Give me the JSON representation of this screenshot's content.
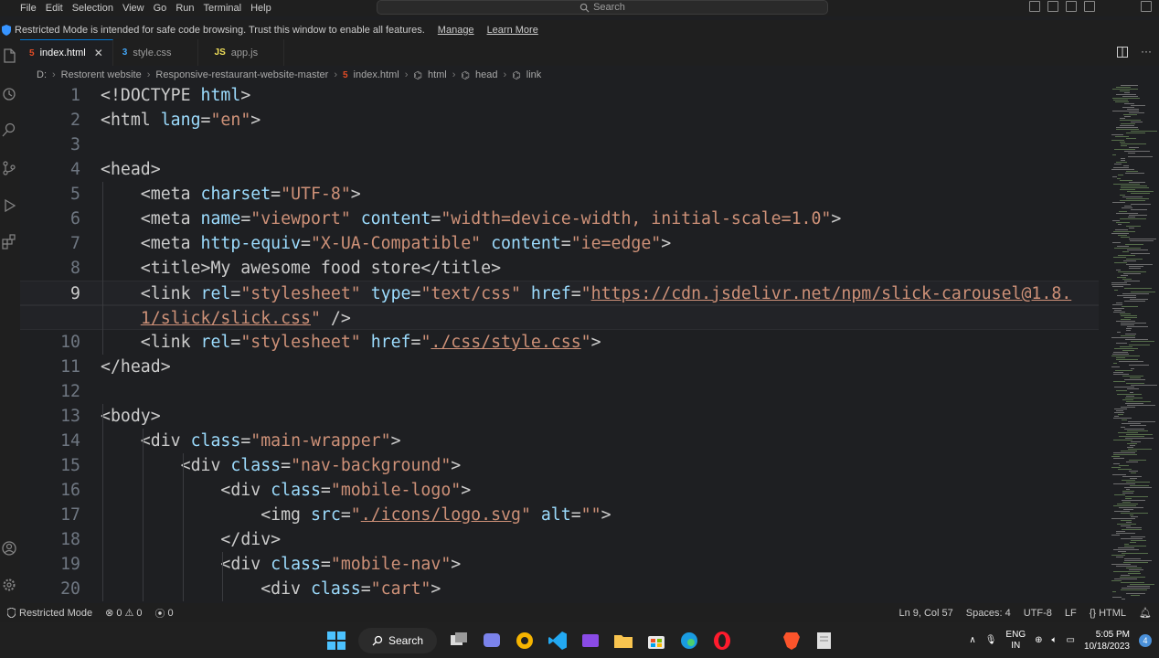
{
  "menu": [
    "File",
    "Edit",
    "Selection",
    "View",
    "Go",
    "Run",
    "Terminal",
    "Help"
  ],
  "command_center": {
    "placeholder": "Search"
  },
  "restricted_bar": {
    "message": "Restricted Mode is intended for safe code browsing. Trust this window to enable all features.",
    "manage": "Manage",
    "learn_more": "Learn More"
  },
  "tabs": [
    {
      "label": "index.html",
      "icon": "html-file-icon",
      "icon_text": "5",
      "active": true
    },
    {
      "label": "style.css",
      "icon": "css-file-icon",
      "icon_text": "3",
      "active": false
    },
    {
      "label": "app.js",
      "icon": "js-file-icon",
      "icon_text": "JS",
      "active": false
    }
  ],
  "breadcrumb": [
    "D:",
    "Restorent website",
    "Responsive-restaurant-website-master",
    "index.html",
    "html",
    "head",
    "link"
  ],
  "editor": {
    "current_line": 9,
    "lines": [
      {
        "n": "1",
        "tokens": [
          [
            "p",
            "<!"
          ],
          [
            "t",
            "DOCTYPE"
          ],
          [
            "p",
            " "
          ],
          [
            "a",
            "html"
          ],
          [
            "p",
            ">"
          ]
        ]
      },
      {
        "n": "2",
        "tokens": [
          [
            "p",
            "<"
          ],
          [
            "t",
            "html"
          ],
          [
            "p",
            " "
          ],
          [
            "a",
            "lang"
          ],
          [
            "p",
            "="
          ],
          [
            "s",
            "\"en\""
          ],
          [
            "p",
            ">"
          ]
        ]
      },
      {
        "n": "3",
        "tokens": []
      },
      {
        "n": "4",
        "tokens": [
          [
            "p",
            "<"
          ],
          [
            "t",
            "head"
          ],
          [
            "p",
            ">"
          ]
        ]
      },
      {
        "n": "5",
        "tokens": [
          [
            "p",
            "    <"
          ],
          [
            "t",
            "meta"
          ],
          [
            "p",
            " "
          ],
          [
            "a",
            "charset"
          ],
          [
            "p",
            "="
          ],
          [
            "s",
            "\"UTF-8\""
          ],
          [
            "p",
            ">"
          ]
        ]
      },
      {
        "n": "6",
        "tokens": [
          [
            "p",
            "    <"
          ],
          [
            "t",
            "meta"
          ],
          [
            "p",
            " "
          ],
          [
            "a",
            "name"
          ],
          [
            "p",
            "="
          ],
          [
            "s",
            "\"viewport\""
          ],
          [
            "p",
            " "
          ],
          [
            "a",
            "content"
          ],
          [
            "p",
            "="
          ],
          [
            "s",
            "\"width=device-width, initial-scale=1.0\""
          ],
          [
            "p",
            ">"
          ]
        ]
      },
      {
        "n": "7",
        "tokens": [
          [
            "p",
            "    <"
          ],
          [
            "t",
            "meta"
          ],
          [
            "p",
            " "
          ],
          [
            "a",
            "http-equiv"
          ],
          [
            "p",
            "="
          ],
          [
            "s",
            "\"X-UA-Compatible\""
          ],
          [
            "p",
            " "
          ],
          [
            "a",
            "content"
          ],
          [
            "p",
            "="
          ],
          [
            "s",
            "\"ie=edge\""
          ],
          [
            "p",
            ">"
          ]
        ]
      },
      {
        "n": "8",
        "tokens": [
          [
            "p",
            "    <"
          ],
          [
            "t",
            "title"
          ],
          [
            "p",
            ">"
          ],
          [
            "x",
            "My awesome food store"
          ],
          [
            "p",
            "</"
          ],
          [
            "t",
            "title"
          ],
          [
            "p",
            ">"
          ]
        ]
      },
      {
        "n": "9",
        "tokens": [
          [
            "p",
            "    <"
          ],
          [
            "t",
            "link"
          ],
          [
            "p",
            " "
          ],
          [
            "a",
            "rel"
          ],
          [
            "p",
            "="
          ],
          [
            "s",
            "\"stylesheet\""
          ],
          [
            "p",
            " "
          ],
          [
            "a",
            "type"
          ],
          [
            "p",
            "="
          ],
          [
            "s",
            "\"text/css\""
          ],
          [
            "p",
            " "
          ],
          [
            "a",
            "href"
          ],
          [
            "p",
            "="
          ],
          [
            "s",
            "\""
          ],
          [
            "l",
            "https://cdn.jsdelivr.net/npm/slick-carousel@1.8."
          ]
        ]
      },
      {
        "n": "",
        "tokens": [
          [
            "p",
            "    "
          ],
          [
            "l",
            "1/slick/slick.css"
          ],
          [
            "s",
            "\""
          ],
          [
            "p",
            " />"
          ]
        ]
      },
      {
        "n": "10",
        "tokens": [
          [
            "p",
            "    <"
          ],
          [
            "t",
            "link"
          ],
          [
            "p",
            " "
          ],
          [
            "a",
            "rel"
          ],
          [
            "p",
            "="
          ],
          [
            "s",
            "\"stylesheet\""
          ],
          [
            "p",
            " "
          ],
          [
            "a",
            "href"
          ],
          [
            "p",
            "="
          ],
          [
            "s",
            "\""
          ],
          [
            "l",
            "./css/style.css"
          ],
          [
            "s",
            "\""
          ],
          [
            "p",
            ">"
          ]
        ]
      },
      {
        "n": "11",
        "tokens": [
          [
            "p",
            "</"
          ],
          [
            "t",
            "head"
          ],
          [
            "p",
            ">"
          ]
        ]
      },
      {
        "n": "12",
        "tokens": []
      },
      {
        "n": "13",
        "tokens": [
          [
            "p",
            "<"
          ],
          [
            "t",
            "body"
          ],
          [
            "p",
            ">"
          ]
        ]
      },
      {
        "n": "14",
        "tokens": [
          [
            "p",
            "    <"
          ],
          [
            "t",
            "div"
          ],
          [
            "p",
            " "
          ],
          [
            "a",
            "class"
          ],
          [
            "p",
            "="
          ],
          [
            "s",
            "\"main-wrapper\""
          ],
          [
            "p",
            ">"
          ]
        ]
      },
      {
        "n": "15",
        "tokens": [
          [
            "p",
            "        <"
          ],
          [
            "t",
            "div"
          ],
          [
            "p",
            " "
          ],
          [
            "a",
            "class"
          ],
          [
            "p",
            "="
          ],
          [
            "s",
            "\"nav-background\""
          ],
          [
            "p",
            ">"
          ]
        ]
      },
      {
        "n": "16",
        "tokens": [
          [
            "p",
            "            <"
          ],
          [
            "t",
            "div"
          ],
          [
            "p",
            " "
          ],
          [
            "a",
            "class"
          ],
          [
            "p",
            "="
          ],
          [
            "s",
            "\"mobile-logo\""
          ],
          [
            "p",
            ">"
          ]
        ]
      },
      {
        "n": "17",
        "tokens": [
          [
            "p",
            "                <"
          ],
          [
            "t",
            "img"
          ],
          [
            "p",
            " "
          ],
          [
            "a",
            "src"
          ],
          [
            "p",
            "="
          ],
          [
            "s",
            "\""
          ],
          [
            "l",
            "./icons/logo.svg"
          ],
          [
            "s",
            "\""
          ],
          [
            "p",
            " "
          ],
          [
            "a",
            "alt"
          ],
          [
            "p",
            "="
          ],
          [
            "s",
            "\"\""
          ],
          [
            "p",
            ">"
          ]
        ]
      },
      {
        "n": "18",
        "tokens": [
          [
            "p",
            "            </"
          ],
          [
            "t",
            "div"
          ],
          [
            "p",
            ">"
          ]
        ]
      },
      {
        "n": "19",
        "tokens": [
          [
            "p",
            "            <"
          ],
          [
            "t",
            "div"
          ],
          [
            "p",
            " "
          ],
          [
            "a",
            "class"
          ],
          [
            "p",
            "="
          ],
          [
            "s",
            "\"mobile-nav\""
          ],
          [
            "p",
            ">"
          ]
        ]
      },
      {
        "n": "20",
        "tokens": [
          [
            "p",
            "                <"
          ],
          [
            "t",
            "div"
          ],
          [
            "p",
            " "
          ],
          [
            "a",
            "class"
          ],
          [
            "p",
            "="
          ],
          [
            "s",
            "\"cart\""
          ],
          [
            "p",
            ">"
          ]
        ]
      }
    ]
  },
  "statusbar": {
    "restricted": "Restricted Mode",
    "errors": "0",
    "warnings": "0",
    "ports": "0",
    "position": "Ln 9, Col 57",
    "spaces": "Spaces: 4",
    "encoding": "UTF-8",
    "eol": "LF",
    "language": "HTML"
  },
  "taskbar": {
    "search_label": "Search",
    "lang_top": "ENG",
    "lang_bottom": "IN",
    "time": "5:05 PM",
    "date": "10/18/2023",
    "notifications": "4",
    "apps": [
      "windows-start-icon",
      "task-view-icon",
      "chat-icon",
      "browser-icon",
      "vscode-icon",
      "clipchamp-icon",
      "file-explorer-icon",
      "store-icon",
      "edge-icon",
      "opera-icon",
      "brave-icon",
      "notepad-icon"
    ]
  },
  "colors": {
    "background": "#1e1f22",
    "chrome": "#1f1f1f",
    "attr": "#9cdcfe",
    "string": "#ce9178",
    "text": "#cccccc",
    "accent": "#0078d4"
  }
}
